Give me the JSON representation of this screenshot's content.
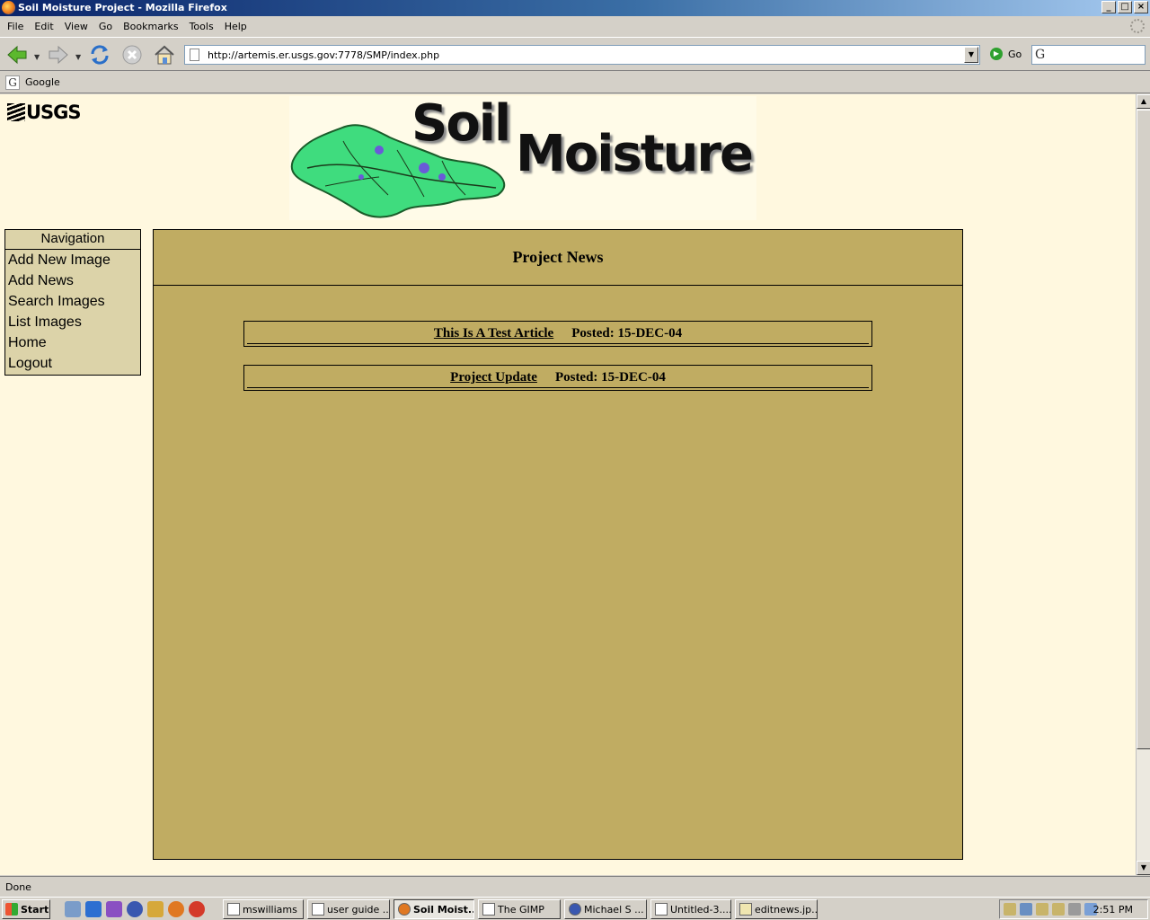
{
  "window": {
    "title": "Soil Moisture Project - Mozilla Firefox",
    "buttons": [
      "_",
      "□",
      "×"
    ]
  },
  "menubar": {
    "items": [
      "File",
      "Edit",
      "View",
      "Go",
      "Bookmarks",
      "Tools",
      "Help"
    ]
  },
  "toolbar": {
    "url": "http://artemis.er.usgs.gov:7778/SMP/index.php",
    "go_label": "Go"
  },
  "bookmarks": {
    "items": [
      "Google"
    ]
  },
  "page": {
    "logo_text": "USGS",
    "banner": {
      "line1": "Soil",
      "line2": "Moisture"
    },
    "nav": {
      "heading": "Navigation",
      "links": [
        "Add New Image",
        "Add News",
        "Search Images",
        "List Images",
        "Home",
        "Logout"
      ]
    },
    "news": {
      "heading": "Project News",
      "articles": [
        {
          "title": "This Is A Test Article",
          "posted": "Posted: 15-DEC-04"
        },
        {
          "title": "Project Update",
          "posted": "Posted: 15-DEC-04"
        }
      ]
    }
  },
  "statusbar": {
    "text": "Done"
  },
  "taskbar": {
    "start_label": "Start",
    "tasks": [
      "mswilliams",
      "user guide ...",
      "Soil Moist...",
      "The GIMP",
      "Michael S ...",
      "Untitled-3....",
      "editnews.jp..."
    ],
    "clock": "2:51 PM"
  },
  "colors": {
    "page_bg": "#fff8df",
    "panel_bg": "#c0ac62",
    "nav_bg": "#dcd3a9"
  }
}
